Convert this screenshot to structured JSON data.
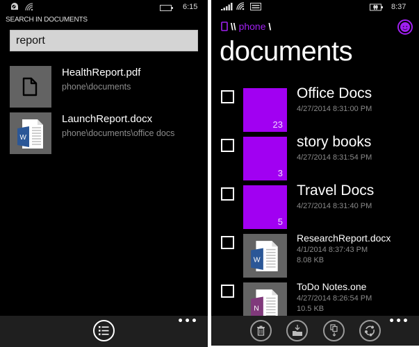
{
  "left": {
    "status": {
      "icons": [
        "notification-icon",
        "wifi-icon",
        "battery-icon"
      ],
      "time": "6:15"
    },
    "search": {
      "title": "SEARCH IN DOCUMENTS",
      "value": "report",
      "placeholder": ""
    },
    "results": [
      {
        "name": "HealthReport.pdf",
        "path": "phone\\documents",
        "icon": "generic-file-icon"
      },
      {
        "name": "LaunchReport.docx",
        "path": "phone\\documents\\office docs",
        "icon": "word-file-icon"
      }
    ],
    "appbar": {
      "buttons": [
        {
          "icon": "list-view-icon",
          "label": "list"
        }
      ],
      "more": "•••"
    }
  },
  "right": {
    "status": {
      "icons": [
        "signal-icon",
        "wifi-icon",
        "message-icon",
        "battery-charging-icon"
      ],
      "time": "8:37"
    },
    "breadcrumb": {
      "root_sep": "\\\\",
      "location": "phone",
      "trail_sep": "\\"
    },
    "title": "documents",
    "accent_color": "#a100f2",
    "items": [
      {
        "type": "folder",
        "name": "Office Docs",
        "date": "4/27/2014 8:31:00 PM",
        "count": "23",
        "checked": false
      },
      {
        "type": "folder",
        "name": "story books",
        "date": "4/27/2014 8:31:54 PM",
        "count": "3",
        "checked": false
      },
      {
        "type": "folder",
        "name": "Travel Docs",
        "date": "4/27/2014 8:31:40 PM",
        "count": "5",
        "checked": false
      },
      {
        "type": "file",
        "name": "ResearchReport.docx",
        "date": "4/1/2014 8:37:43 PM",
        "size": "8.08 KB",
        "badge": "W",
        "badge_color": "#2b5797",
        "checked": false
      },
      {
        "type": "file",
        "name": "ToDo Notes.one",
        "date": "4/27/2014 8:26:54 PM",
        "size": "10.5 KB",
        "badge": "N",
        "badge_color": "#80397b",
        "checked": false
      }
    ],
    "appbar": {
      "buttons": [
        {
          "icon": "delete-icon",
          "label": "delete"
        },
        {
          "icon": "move-to-folder-icon",
          "label": "move"
        },
        {
          "icon": "copy-icon",
          "label": "copy"
        },
        {
          "icon": "share-icon",
          "label": "share"
        }
      ],
      "more": "•••"
    }
  }
}
